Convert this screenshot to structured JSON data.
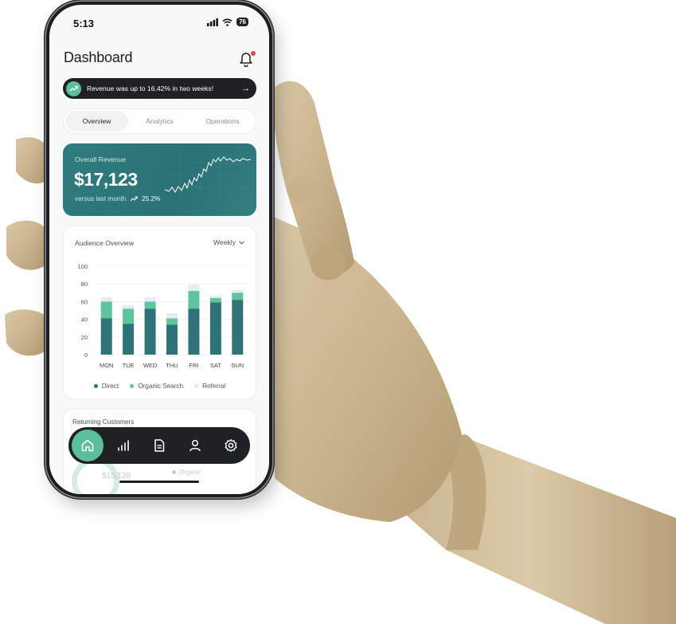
{
  "status_bar": {
    "time": "5:13",
    "battery": "76"
  },
  "header": {
    "title": "Dashboard"
  },
  "banner": {
    "text": "Revenue was up to 16.42% in two weeks!"
  },
  "tabs": [
    {
      "label": "Overview",
      "active": true
    },
    {
      "label": "Analytics",
      "active": false
    },
    {
      "label": "Operations",
      "active": false
    }
  ],
  "revenue": {
    "label": "Overall Revenue",
    "amount": "$17,123",
    "comparison_label": "versus last month",
    "change": "25.2%"
  },
  "audience": {
    "title": "Audience Overview",
    "period": "Weekly"
  },
  "chart_data": {
    "type": "bar",
    "stacked": true,
    "categories": [
      "MON",
      "TUE",
      "WED",
      "THU",
      "FRI",
      "SAT",
      "SUN"
    ],
    "series": [
      {
        "name": "Direct",
        "color": "#2e7376",
        "values": [
          41,
          35,
          52,
          34,
          52,
          59,
          62
        ]
      },
      {
        "name": "Organic Search",
        "color": "#5ec49c",
        "values": [
          19,
          17,
          8,
          7,
          20,
          5,
          8
        ]
      },
      {
        "name": "Referral",
        "color": "#e6ebf7",
        "values": [
          5,
          4,
          5,
          6,
          7,
          3,
          3
        ]
      }
    ],
    "yticks": [
      0,
      20,
      40,
      60,
      80,
      100
    ],
    "ylim": [
      0,
      100
    ],
    "grid": true,
    "legend": "bottom"
  },
  "returning": {
    "title": "Returning Customers",
    "value": "$15,128",
    "legend_label": "Organic"
  },
  "nav": [
    {
      "icon": "home-icon",
      "active": true
    },
    {
      "icon": "bar-chart-icon",
      "active": false
    },
    {
      "icon": "document-icon",
      "active": false
    },
    {
      "icon": "user-icon",
      "active": false
    },
    {
      "icon": "settings-icon",
      "active": false
    }
  ],
  "colors": {
    "accent": "#5abf9a",
    "teal": "#2f7a7d",
    "dark": "#1e2222"
  }
}
